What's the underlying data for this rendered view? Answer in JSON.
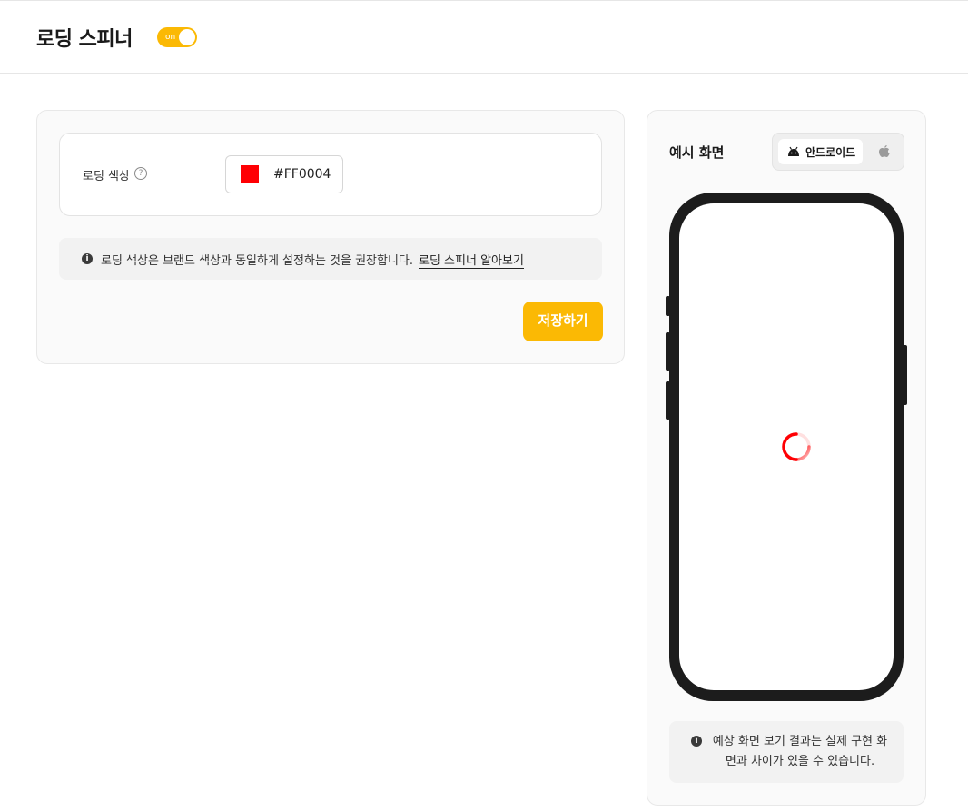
{
  "header": {
    "title": "로딩 스피너",
    "toggle_label": "on",
    "toggle_state": "on",
    "accent_color": "#FBB904"
  },
  "settings": {
    "color_label": "로딩 색상",
    "help_icon": "question-circle-icon",
    "color_value": "#FF0004",
    "info_icon": "info-icon",
    "info_text": "로딩 색상은 브랜드 색상과 동일하게 설정하는 것을 권장합니다.",
    "info_link": "로딩 스피너 알아보기",
    "save_label": "저장하기"
  },
  "preview": {
    "title": "예시 화면",
    "os_tabs": [
      {
        "label": "안드로이드",
        "icon": "android-icon",
        "selected": true
      },
      {
        "label": "",
        "icon": "apple-icon",
        "selected": false
      }
    ],
    "spinner_color": "#FF0004",
    "note_icon": "info-icon",
    "note_text": "예상 화면 보기 결과는 실제 구현 화면과 차이가 있을 수 있습니다."
  }
}
